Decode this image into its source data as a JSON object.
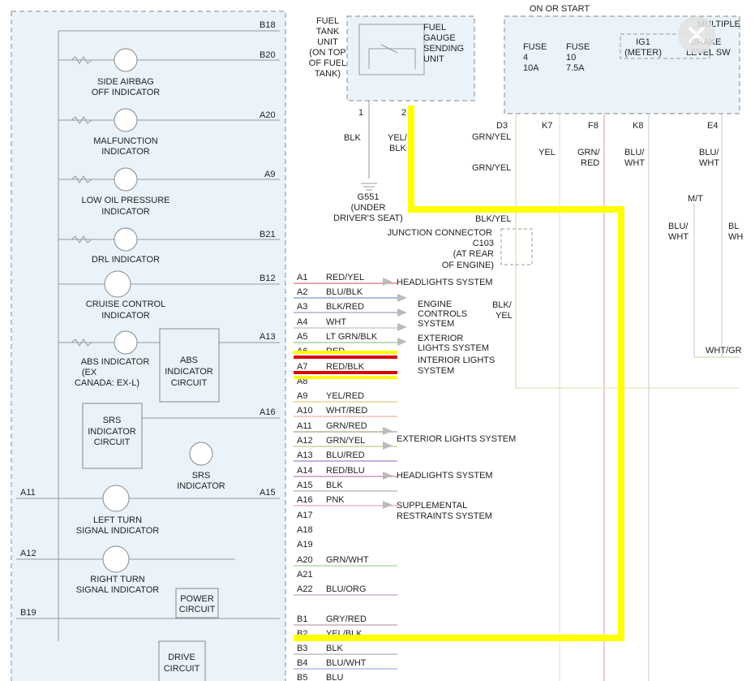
{
  "colors": {
    "highlight_yellow": "#ffff00",
    "highlight_red": "#dd0000",
    "frame": "#e8f2f8"
  },
  "top": {
    "on_or_start": "ON OR START",
    "fuel_tank_unit": [
      "FUEL",
      "TANK",
      "UNIT",
      "(ON TOP",
      "OF FUEL",
      "TANK)"
    ],
    "fuel_gauge": [
      "FUEL",
      "GAUGE",
      "SENDING",
      "UNIT"
    ],
    "fuse4": [
      "FUSE",
      "4",
      "10A"
    ],
    "fuse10": [
      "FUSE",
      "10",
      "7.5A"
    ],
    "ig1": [
      "IG1",
      "(METER)"
    ],
    "multiplex": [
      "MULTIPLE",
      "BRAKE",
      "LEVEL SW"
    ],
    "pin1": "1",
    "pin2": "2",
    "blk": "BLK",
    "yel_blk": [
      "YEL/",
      "BLK"
    ],
    "g551": [
      "G551",
      "(UNDER",
      "DRIVER'S SEAT)"
    ],
    "d3": "D3",
    "k7": "K7",
    "f8": "F8",
    "k8": "K8",
    "e4": "E4",
    "grn_yel": "GRN/YEL",
    "grn_yel2": "GRN/YEL",
    "yel": "YEL",
    "grn_red": [
      "GRN/",
      "RED"
    ],
    "blu_wht": [
      "BLU/",
      "WHT"
    ],
    "blu_wht2": [
      "BLU/",
      "WHT"
    ],
    "blk_yel": "BLK/YEL",
    "junction": [
      "JUNCTION CONNECTOR",
      "C103",
      "(AT REAR",
      "OF ENGINE)"
    ],
    "mt": "M/T",
    "blu_wht3": [
      "BLU/",
      "WHT"
    ],
    "bl_wh": [
      "BL",
      "WH"
    ],
    "blk_yel_side": [
      "BLK/",
      "YEL"
    ],
    "wht_gr": "WHT/GR"
  },
  "left": {
    "side_airbag": [
      "SIDE AIRBAG",
      "OFF INDICATOR"
    ],
    "malfunction": [
      "MALFUNCTION",
      "INDICATOR"
    ],
    "low_oil": [
      "LOW OIL PRESSURE",
      "INDICATOR"
    ],
    "drl": "DRL INDICATOR",
    "cruise": [
      "CRUISE CONTROL",
      "INDICATOR"
    ],
    "abs_ind": [
      "ABS INDICATOR",
      "(EX",
      "CANADA: EX-L)"
    ],
    "abs_circuit": [
      "ABS",
      "INDICATOR",
      "CIRCUIT"
    ],
    "srs_circuit": [
      "SRS",
      "INDICATOR",
      "CIRCUIT"
    ],
    "srs_ind": [
      "SRS",
      "INDICATOR"
    ],
    "left_turn": [
      "LEFT TURN",
      "SIGNAL INDICATOR"
    ],
    "right_turn": [
      "RIGHT TURN",
      "SIGNAL INDICATOR"
    ],
    "power_circuit": [
      "POWER",
      "CIRCUIT"
    ],
    "drive_circuit": [
      "DRIVE",
      "CIRCUIT"
    ],
    "tags": {
      "b18": "B18",
      "b20": "B20",
      "a20": "A20",
      "a9": "A9",
      "b21": "B21",
      "b12": "B12",
      "a13": "A13",
      "a16": "A16",
      "a15": "A15",
      "a11": "A11",
      "a12": "A12",
      "b19": "B19"
    }
  },
  "pins": [
    {
      "pin": "A1",
      "wire": "RED/YEL",
      "color": "#e07070"
    },
    {
      "pin": "A2",
      "wire": "BLU/BLK",
      "color": "#8090d0"
    },
    {
      "pin": "A3",
      "wire": "BLK/RED",
      "color": "#a0a0c0"
    },
    {
      "pin": "A4",
      "wire": "WHT",
      "color": "#c0c0c0"
    },
    {
      "pin": "A5",
      "wire": "LT GRN/BLK",
      "color": "#90c890"
    },
    {
      "pin": "A6",
      "wire": "RED",
      "color": "#e04040"
    },
    {
      "pin": "A7",
      "wire": "RED/BLK",
      "color": "#d06060"
    },
    {
      "pin": "A8",
      "wire": "",
      "color": ""
    },
    {
      "pin": "A9",
      "wire": "YEL/RED",
      "color": "#e8c880"
    },
    {
      "pin": "A10",
      "wire": "WHT/RED",
      "color": "#f0b0a0"
    },
    {
      "pin": "A11",
      "wire": "GRN/RED",
      "color": "#b0a080"
    },
    {
      "pin": "A12",
      "wire": "GRN/YEL",
      "color": "#b8d080"
    },
    {
      "pin": "A13",
      "wire": "BLU/RED",
      "color": "#a080c0"
    },
    {
      "pin": "A14",
      "wire": "RED/BLU",
      "color": "#c080b0"
    },
    {
      "pin": "A15",
      "wire": "BLK",
      "color": "#b0b0b0"
    },
    {
      "pin": "A16",
      "wire": "PNK",
      "color": "#f0a0c0"
    },
    {
      "pin": "A17",
      "wire": "",
      "color": ""
    },
    {
      "pin": "A18",
      "wire": "",
      "color": ""
    },
    {
      "pin": "A19",
      "wire": "",
      "color": ""
    },
    {
      "pin": "A20",
      "wire": "GRN/WHT",
      "color": "#a0d0a0"
    },
    {
      "pin": "A21",
      "wire": "",
      "color": ""
    },
    {
      "pin": "A22",
      "wire": "BLU/ORG",
      "color": "#c0a0d0"
    },
    {
      "pin": "B1",
      "wire": "GRY/RED",
      "color": "#c0a0a0"
    },
    {
      "pin": "B2",
      "wire": "YEL/BLK",
      "color": "#e0e080"
    },
    {
      "pin": "B3",
      "wire": "BLK",
      "color": "#b0b0b0"
    },
    {
      "pin": "B4",
      "wire": "BLU/WHT",
      "color": "#a0b0e0"
    },
    {
      "pin": "B5",
      "wire": "BLU",
      "color": "#9090e0"
    }
  ],
  "systems": {
    "headlights1": "HEADLIGHTS SYSTEM",
    "engine": [
      "ENGINE",
      "CONTROLS",
      "SYSTEM"
    ],
    "exterior1": [
      "EXTERIOR",
      "LIGHTS SYSTEM"
    ],
    "interior": [
      "INTERIOR LIGHTS",
      "SYSTEM"
    ],
    "exterior2": "EXTERIOR LIGHTS SYSTEM",
    "headlights2": "HEADLIGHTS SYSTEM",
    "srs": [
      "SUPPLEMENTAL",
      "RESTRAINTS SYSTEM"
    ]
  }
}
